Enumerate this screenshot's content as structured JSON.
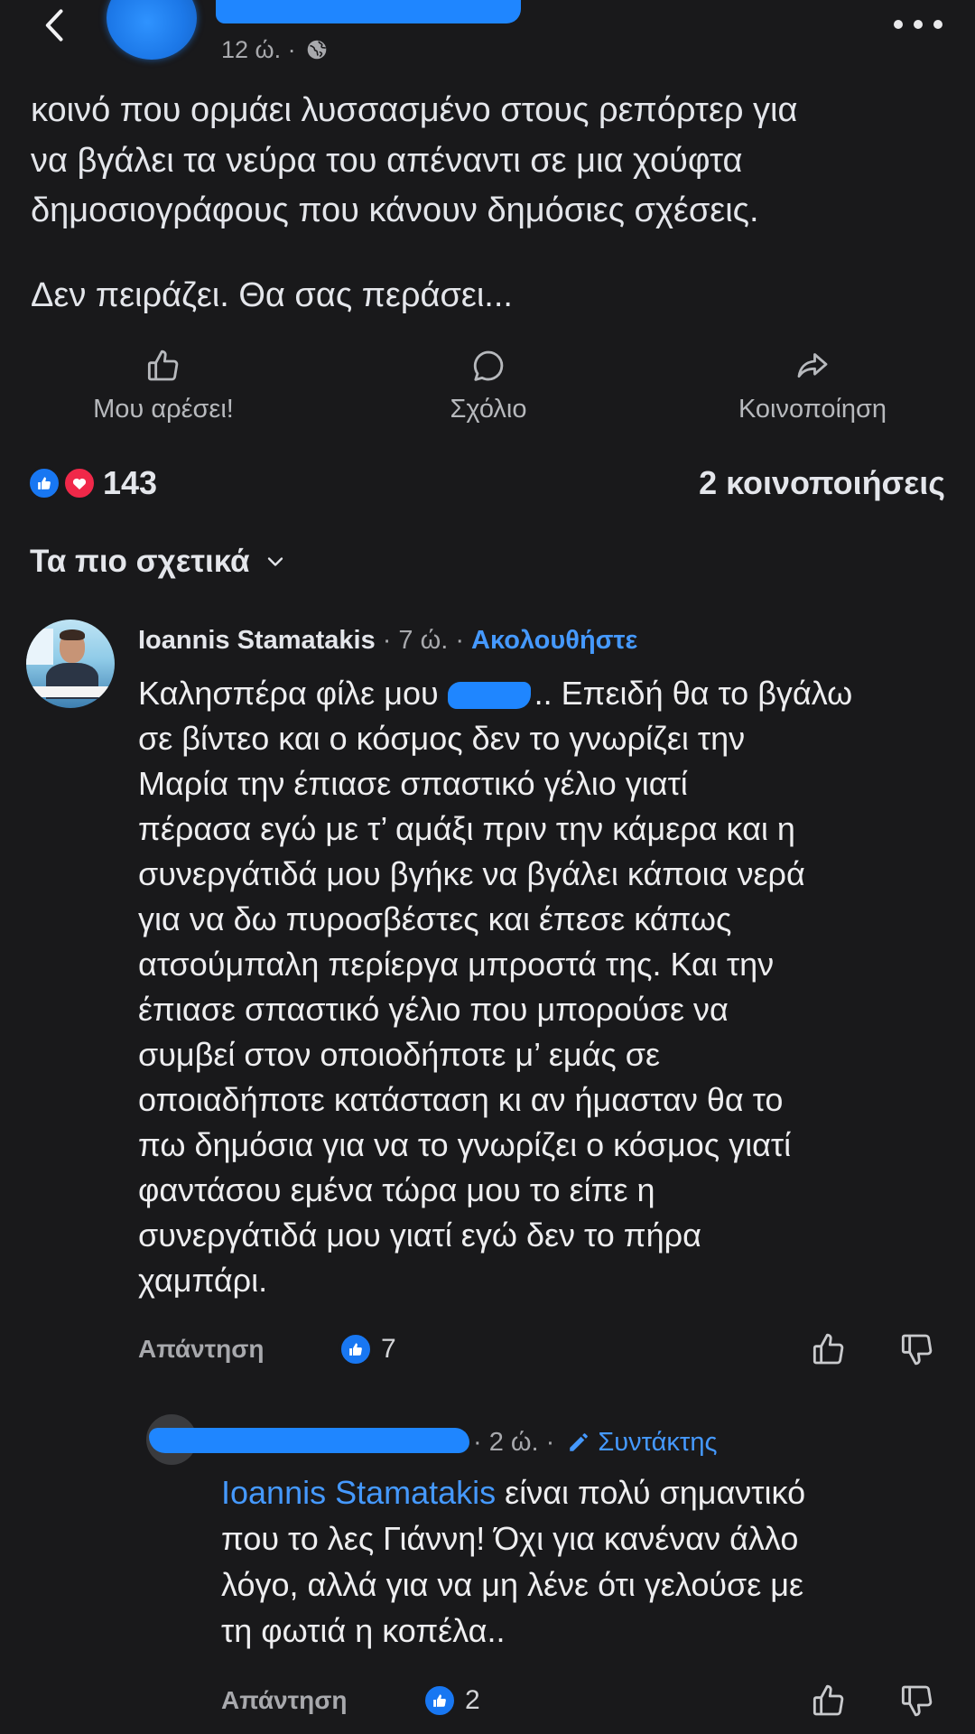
{
  "colors": {
    "background": "#19191b",
    "text": "#e4e6eb",
    "secondary": "#a8a9ad",
    "link": "#4599ff",
    "like_blue": "#1877f2",
    "love_red": "#f02849",
    "redaction": "#1f86ff"
  },
  "header": {
    "meta": "12 ώ. ·",
    "back_icon": "back-chevron-icon",
    "privacy_icon": "globe-icon",
    "more_icon": "more-dots-icon"
  },
  "post": {
    "lines": [
      "κοινό που ορμάει λυσσασμένο στους ρεπόρτερ για",
      "να βγάλει τα νεύρα του απέναντι σε μια χούφτα",
      "δημοσιογράφους που κάνουν δημόσιες σχέσεις.",
      "Δεν πειράζει. Θα σας περάσει..."
    ]
  },
  "actions": [
    {
      "label": "Μου αρέσει!",
      "icon": "like-outline-icon"
    },
    {
      "label": "Σχόλιο",
      "icon": "comment-icon"
    },
    {
      "label": "Κοινοποίηση",
      "icon": "share-icon"
    }
  ],
  "reactions": {
    "count": "143",
    "shares": "2 κοινοποιήσεις",
    "icons": [
      "like-reaction-icon",
      "love-reaction-icon"
    ]
  },
  "sort": {
    "label": "Τα πιο σχετικά",
    "icon": "chevron-down-icon"
  },
  "comments": [
    {
      "author": "Ioannis Stamatakis",
      "meta": "· 7 ώ. ·",
      "follow_label": "Ακολουθήστε",
      "first_line": {
        "before": "Καλησπέρα φίλε μου",
        "after": ".. Επειδή θα το βγάλω"
      },
      "lines": [
        "σε βίντεο και ο κόσμος δεν το γνωρίζει την",
        "Μαρία την έπιασε σπαστικό γέλιο γιατί",
        "πέρασα εγώ με τ’ αμάξι πριν την κάμερα και η",
        "συνεργάτιδά μου βγήκε να βγάλει κάποια νερά",
        "για να δω πυροσβέστες και έπεσε κάπως",
        "ατσούμπαλη περίεργα μπροστά της. Και την",
        "έπιασε σπαστικό γέλιο που μπορούσε να",
        "συμβεί στον οποιοδήποτε μ’ εμάς σε",
        "οποιαδήποτε κατάσταση κι αν ήμασταν θα το",
        "πω δημόσια για να το γνωρίζει ο κόσμος γιατί",
        "φαντάσου εμένα τώρα μου το είπε η",
        "συνεργάτιδά μου γιατί εγώ δεν το πήρα",
        "χαμπάρι."
      ],
      "reply_label": "Απάντηση",
      "like_count": "7",
      "replies": [
        {
          "meta": "· 2 ώ. ·",
          "badge": "Συντάκτης",
          "mention": "Ioannis Stamatakis",
          "first_line_rest": "είναι πολύ σημαντικό",
          "lines": [
            "που το λες Γιάννη! Όχι για κανέναν άλλο",
            "λόγο, αλλά για να μη λένε ότι γελούσε με",
            "τη φωτιά η κοπέλα.."
          ],
          "reply_label": "Απάντηση",
          "like_count": "2"
        }
      ]
    }
  ]
}
